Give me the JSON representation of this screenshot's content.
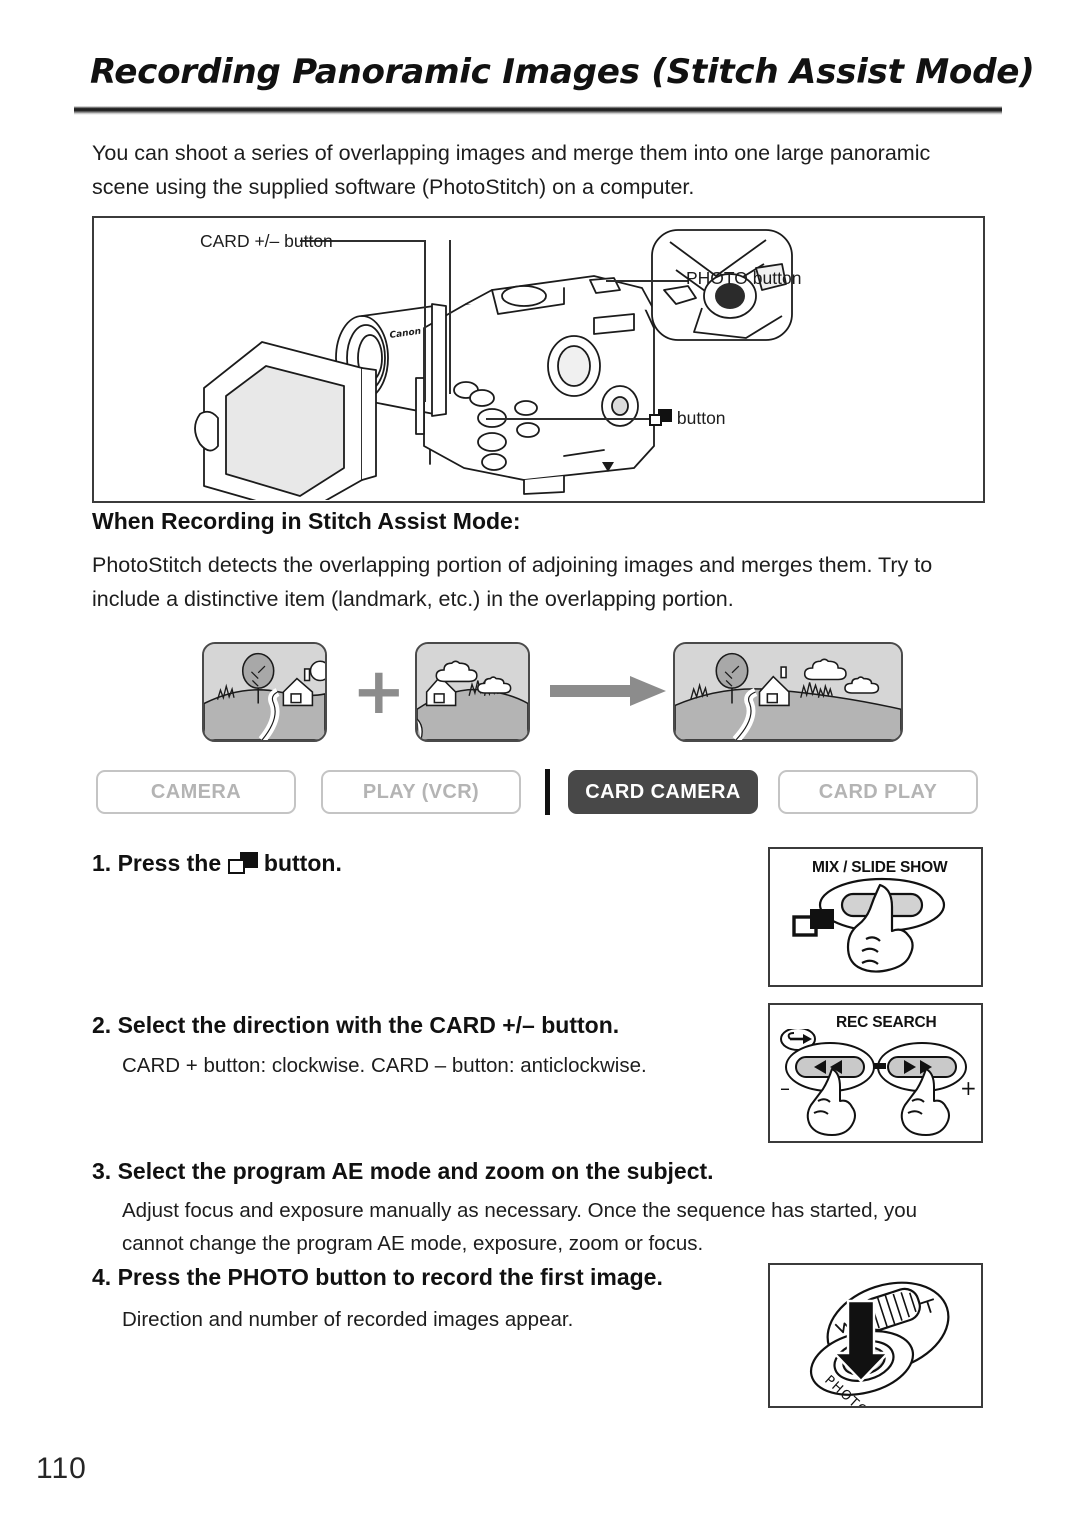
{
  "page": {
    "title": "Recording Panoramic Images (Stitch Assist Mode)",
    "number": "110",
    "intro": "You can shoot a series of overlapping images and merge them into one large panoramic scene using the supplied software (PhotoStitch) on a computer."
  },
  "diagram": {
    "label_card": "CARD +/– button",
    "label_photo": "PHOTO button",
    "label_stitch_button": "button"
  },
  "section": {
    "heading": "When Recording in Stitch Assist Mode:",
    "body": "PhotoStitch detects the overlapping portion of adjoining images and merges them. Try to include a distinctive item (landmark, etc.) in the overlapping portion."
  },
  "illustration_row": {
    "plus_symbol": "+",
    "images": [
      "scene-left",
      "scene-right",
      "scene-merged"
    ]
  },
  "modes": [
    {
      "label": "CAMERA",
      "active": false
    },
    {
      "label": "PLAY (VCR)",
      "active": false
    },
    {
      "label": "CARD CAMERA",
      "active": true
    },
    {
      "label": "CARD PLAY",
      "active": false
    }
  ],
  "steps": [
    {
      "number": "1.",
      "heading_before": "Press the",
      "heading_after": "button.",
      "body": ""
    },
    {
      "number": "2.",
      "heading": "Select the direction with the CARD +/– button.",
      "body": "CARD + button: clockwise. CARD – button: anticlockwise."
    },
    {
      "number": "3.",
      "heading": "Select the program AE mode and zoom on the subject.",
      "body": "Adjust focus and exposure manually as necessary. Once the sequence has started, you cannot change the program AE mode, exposure, zoom or focus."
    },
    {
      "number": "4.",
      "heading": "Press the PHOTO button to record the first image.",
      "body": "Direction and number of recorded images appear."
    }
  ],
  "side_boxes": [
    {
      "caption": "MIX / SLIDE SHOW",
      "icon": "stitch-icon"
    },
    {
      "caption": "REC SEARCH",
      "minus": "–",
      "plus": "+",
      "dash": "-"
    },
    {
      "caption": "",
      "button_label": "PHOTO"
    }
  ],
  "colors": {
    "active_tab_bg": "#484848",
    "inactive_tab_border": "#c4c4c4",
    "inactive_tab_text": "#b4b4b4",
    "rule": "#1a1a1a",
    "thumb_fill": "#d3d3d3",
    "arrow": "#8c8c8c"
  }
}
